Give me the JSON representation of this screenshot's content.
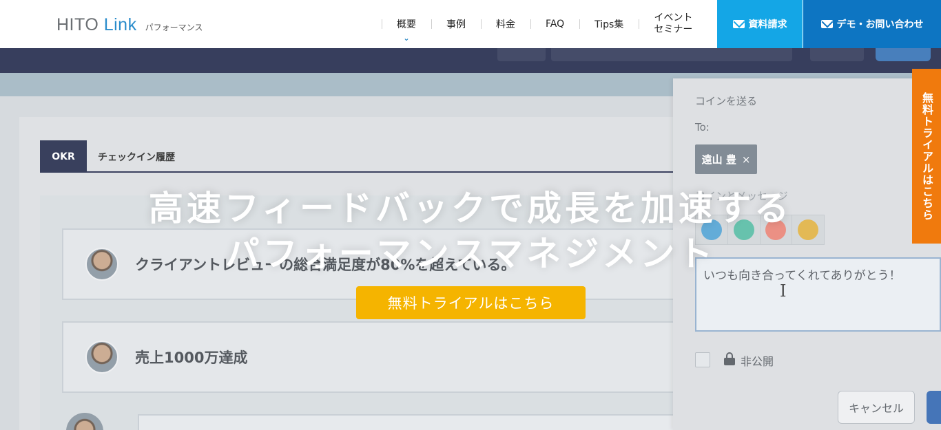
{
  "header": {
    "logo_main": "HITO ",
    "logo_link": "Link",
    "logo_sub": "パフォーマンス",
    "nav": [
      {
        "label": "概要"
      },
      {
        "label": "事例"
      },
      {
        "label": "料金"
      },
      {
        "label": "FAQ"
      },
      {
        "label": "Tips集"
      },
      {
        "label_line1": "イベント",
        "label_line2": "セミナー"
      }
    ],
    "nav_active_icon": "chevron-down-icon",
    "btn_document": "資料請求",
    "btn_demo": "デモ・お問い合わせ",
    "colors": {
      "document": "#14a6e6",
      "demo": "#0d75c2"
    }
  },
  "background_app": {
    "tab_okr": "OKR",
    "tab_history": "チェックイン履歴",
    "rows": [
      {
        "text": "クライアントレビューの総合満足度が80%を超えている。"
      },
      {
        "text": "売上1000万達成"
      }
    ],
    "panel": {
      "title": "コインを送る",
      "to_label": "To:",
      "recipient": "遠山 豊",
      "recipient_remove": "×",
      "message_label": "コインとメッセージ",
      "message_value": "いつも向き合ってくれてありがとう！",
      "private_label": "非公開",
      "cancel": "キャンセル"
    }
  },
  "hero": {
    "title_line1": "高速フィードバックで成長を加速する",
    "title_line2": "パフォーマンスマネジメント",
    "cta": "無料トライアルはこちら",
    "cta_color": "#f5b400"
  },
  "side_tab": {
    "label": "無料トライアルはこちら",
    "color": "#f07a0d"
  }
}
